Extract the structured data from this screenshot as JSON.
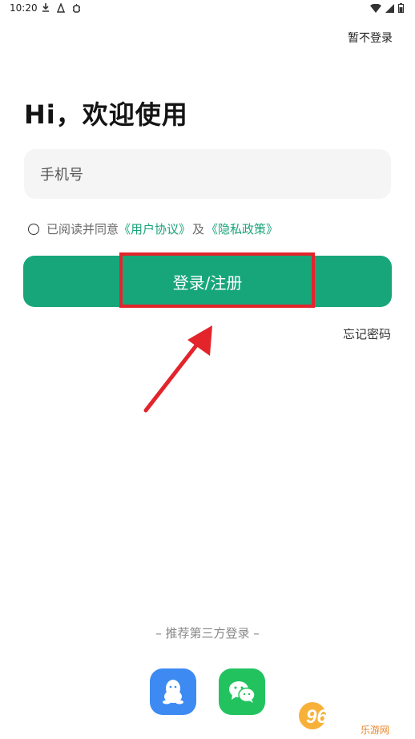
{
  "status_bar": {
    "time": "10:20"
  },
  "header": {
    "skip_label": "暂不登录"
  },
  "welcome": {
    "title": "Hi，欢迎使用"
  },
  "phone": {
    "placeholder": "手机号"
  },
  "agreement": {
    "prefix": "已阅读并同意",
    "user_agreement": "《用户协议》",
    "and": "及",
    "privacy_policy": "《隐私政策》"
  },
  "login": {
    "button_label": "登录/注册"
  },
  "forgot": {
    "label": "忘记密码"
  },
  "third_party": {
    "divider_label": "– 推荐第三方登录 –",
    "providers": [
      {
        "name": "QQ",
        "icon": "qq-icon",
        "color": "#3d8bf2"
      },
      {
        "name": "WeChat",
        "icon": "wechat-icon",
        "color": "#22c35f"
      }
    ]
  },
  "watermark": {
    "brand": "962.NET",
    "sub": "乐游网"
  },
  "colors": {
    "accent": "#17a67a",
    "link": "#1aa37a",
    "annotation": "#e3242b"
  }
}
